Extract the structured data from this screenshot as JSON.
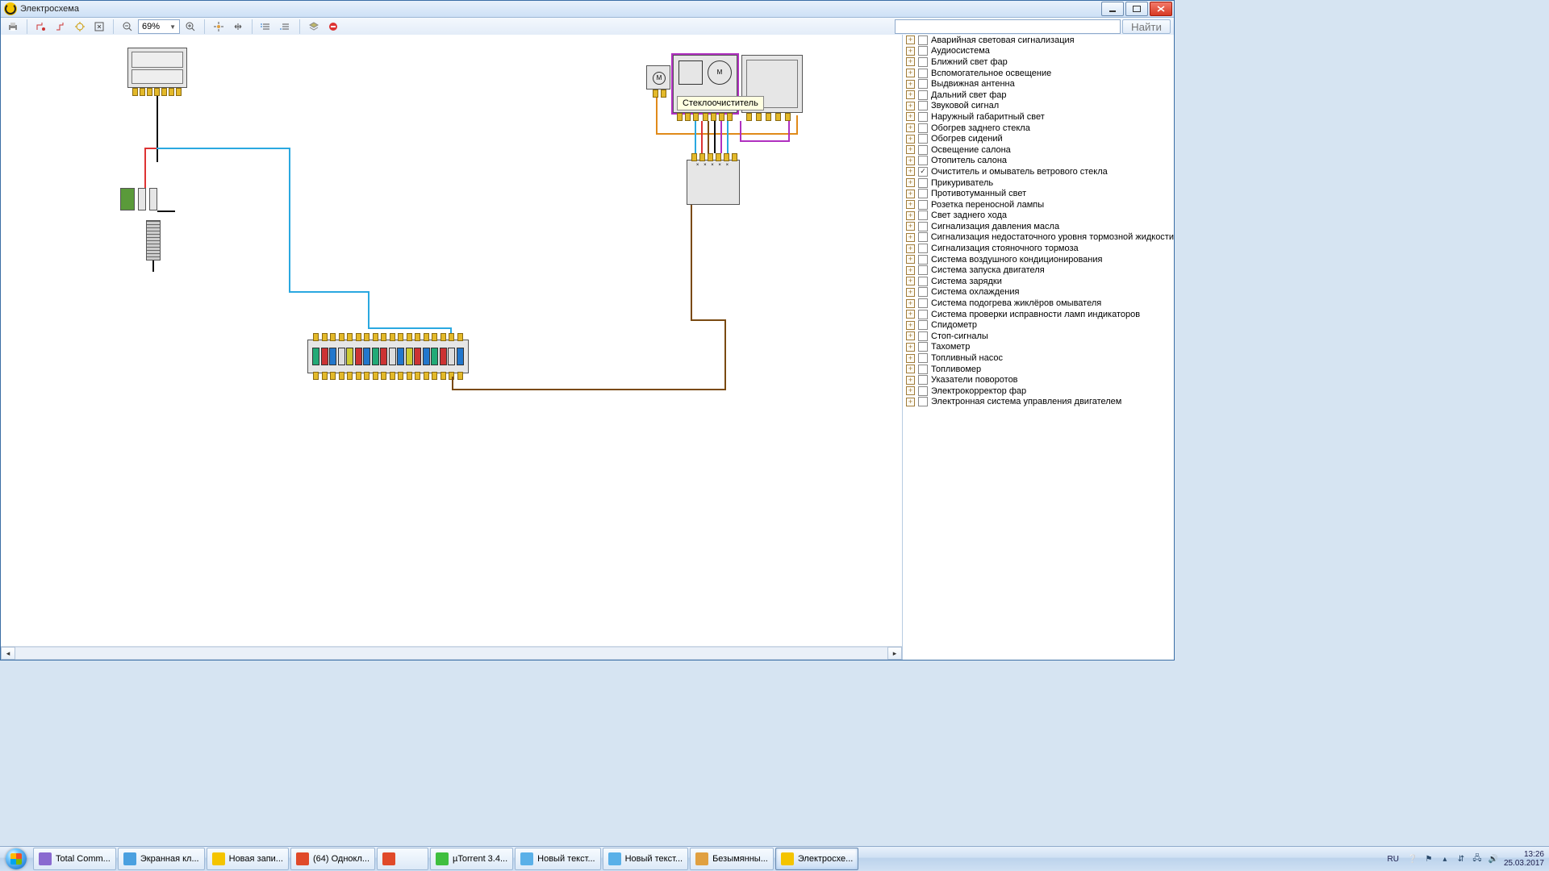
{
  "window": {
    "title": "Электросхема"
  },
  "toolbar": {
    "zoom": "69%",
    "search_placeholder": "",
    "find_label": "Найти"
  },
  "tooltip": "Стеклоочиститель",
  "tree": {
    "items": [
      {
        "label": "Аварийная световая сигнализация",
        "checked": false
      },
      {
        "label": "Аудиосистема",
        "checked": false
      },
      {
        "label": "Ближний свет фар",
        "checked": false
      },
      {
        "label": "Вспомогательное освещение",
        "checked": false
      },
      {
        "label": "Выдвижная антенна",
        "checked": false
      },
      {
        "label": "Дальний свет фар",
        "checked": false
      },
      {
        "label": "Звуковой сигнал",
        "checked": false
      },
      {
        "label": "Наружный габаритный свет",
        "checked": false
      },
      {
        "label": "Обогрев заднего стекла",
        "checked": false
      },
      {
        "label": "Обогрев сидений",
        "checked": false
      },
      {
        "label": "Освещение салона",
        "checked": false
      },
      {
        "label": "Отопитель салона",
        "checked": false
      },
      {
        "label": "Очиститель и омыватель ветрового стекла",
        "checked": true
      },
      {
        "label": "Прикуриватель",
        "checked": false
      },
      {
        "label": "Противотуманный свет",
        "checked": false
      },
      {
        "label": "Розетка переносной лампы",
        "checked": false
      },
      {
        "label": "Свет заднего хода",
        "checked": false
      },
      {
        "label": "Сигнализация давления масла",
        "checked": false
      },
      {
        "label": "Сигнализация недостаточного уровня тормозной жидкости",
        "checked": false
      },
      {
        "label": "Сигнализация стояночного тормоза",
        "checked": false
      },
      {
        "label": "Система воздушного кондиционирования",
        "checked": false
      },
      {
        "label": "Система запуска двигателя",
        "checked": false
      },
      {
        "label": "Система зарядки",
        "checked": false
      },
      {
        "label": "Система охлаждения",
        "checked": false
      },
      {
        "label": "Система подогрева жиклёров омывателя",
        "checked": false
      },
      {
        "label": "Система проверки исправности ламп индикаторов",
        "checked": false
      },
      {
        "label": "Спидометр",
        "checked": false
      },
      {
        "label": "Стоп-сигналы",
        "checked": false
      },
      {
        "label": "Тахометр",
        "checked": false
      },
      {
        "label": "Топливный насос",
        "checked": false
      },
      {
        "label": "Топливомер",
        "checked": false
      },
      {
        "label": "Указатели поворотов",
        "checked": false
      },
      {
        "label": "Электрокорректор фар",
        "checked": false
      },
      {
        "label": "Электронная система управления двигателем",
        "checked": false
      }
    ]
  },
  "taskbar": {
    "items": [
      {
        "label": "Total Comm...",
        "color": "#8a6ad0"
      },
      {
        "label": "Экранная кл...",
        "color": "#4aa0e0"
      },
      {
        "label": "Новая запи...",
        "color": "#f4c400"
      },
      {
        "label": "(64) Однокл...",
        "color": "#e04a2a"
      },
      {
        "label": "",
        "color": "#e04a2a"
      },
      {
        "label": "µTorrent 3.4...",
        "color": "#3fbf3f"
      },
      {
        "label": "Новый текст...",
        "color": "#5ab0e8"
      },
      {
        "label": "Новый текст...",
        "color": "#5ab0e8"
      },
      {
        "label": "Безымянны...",
        "color": "#e0a040"
      },
      {
        "label": "Электросхе...",
        "color": "#f4c400",
        "active": true
      }
    ],
    "lang": "RU",
    "time": "13:26",
    "date": "25.03.2017"
  }
}
